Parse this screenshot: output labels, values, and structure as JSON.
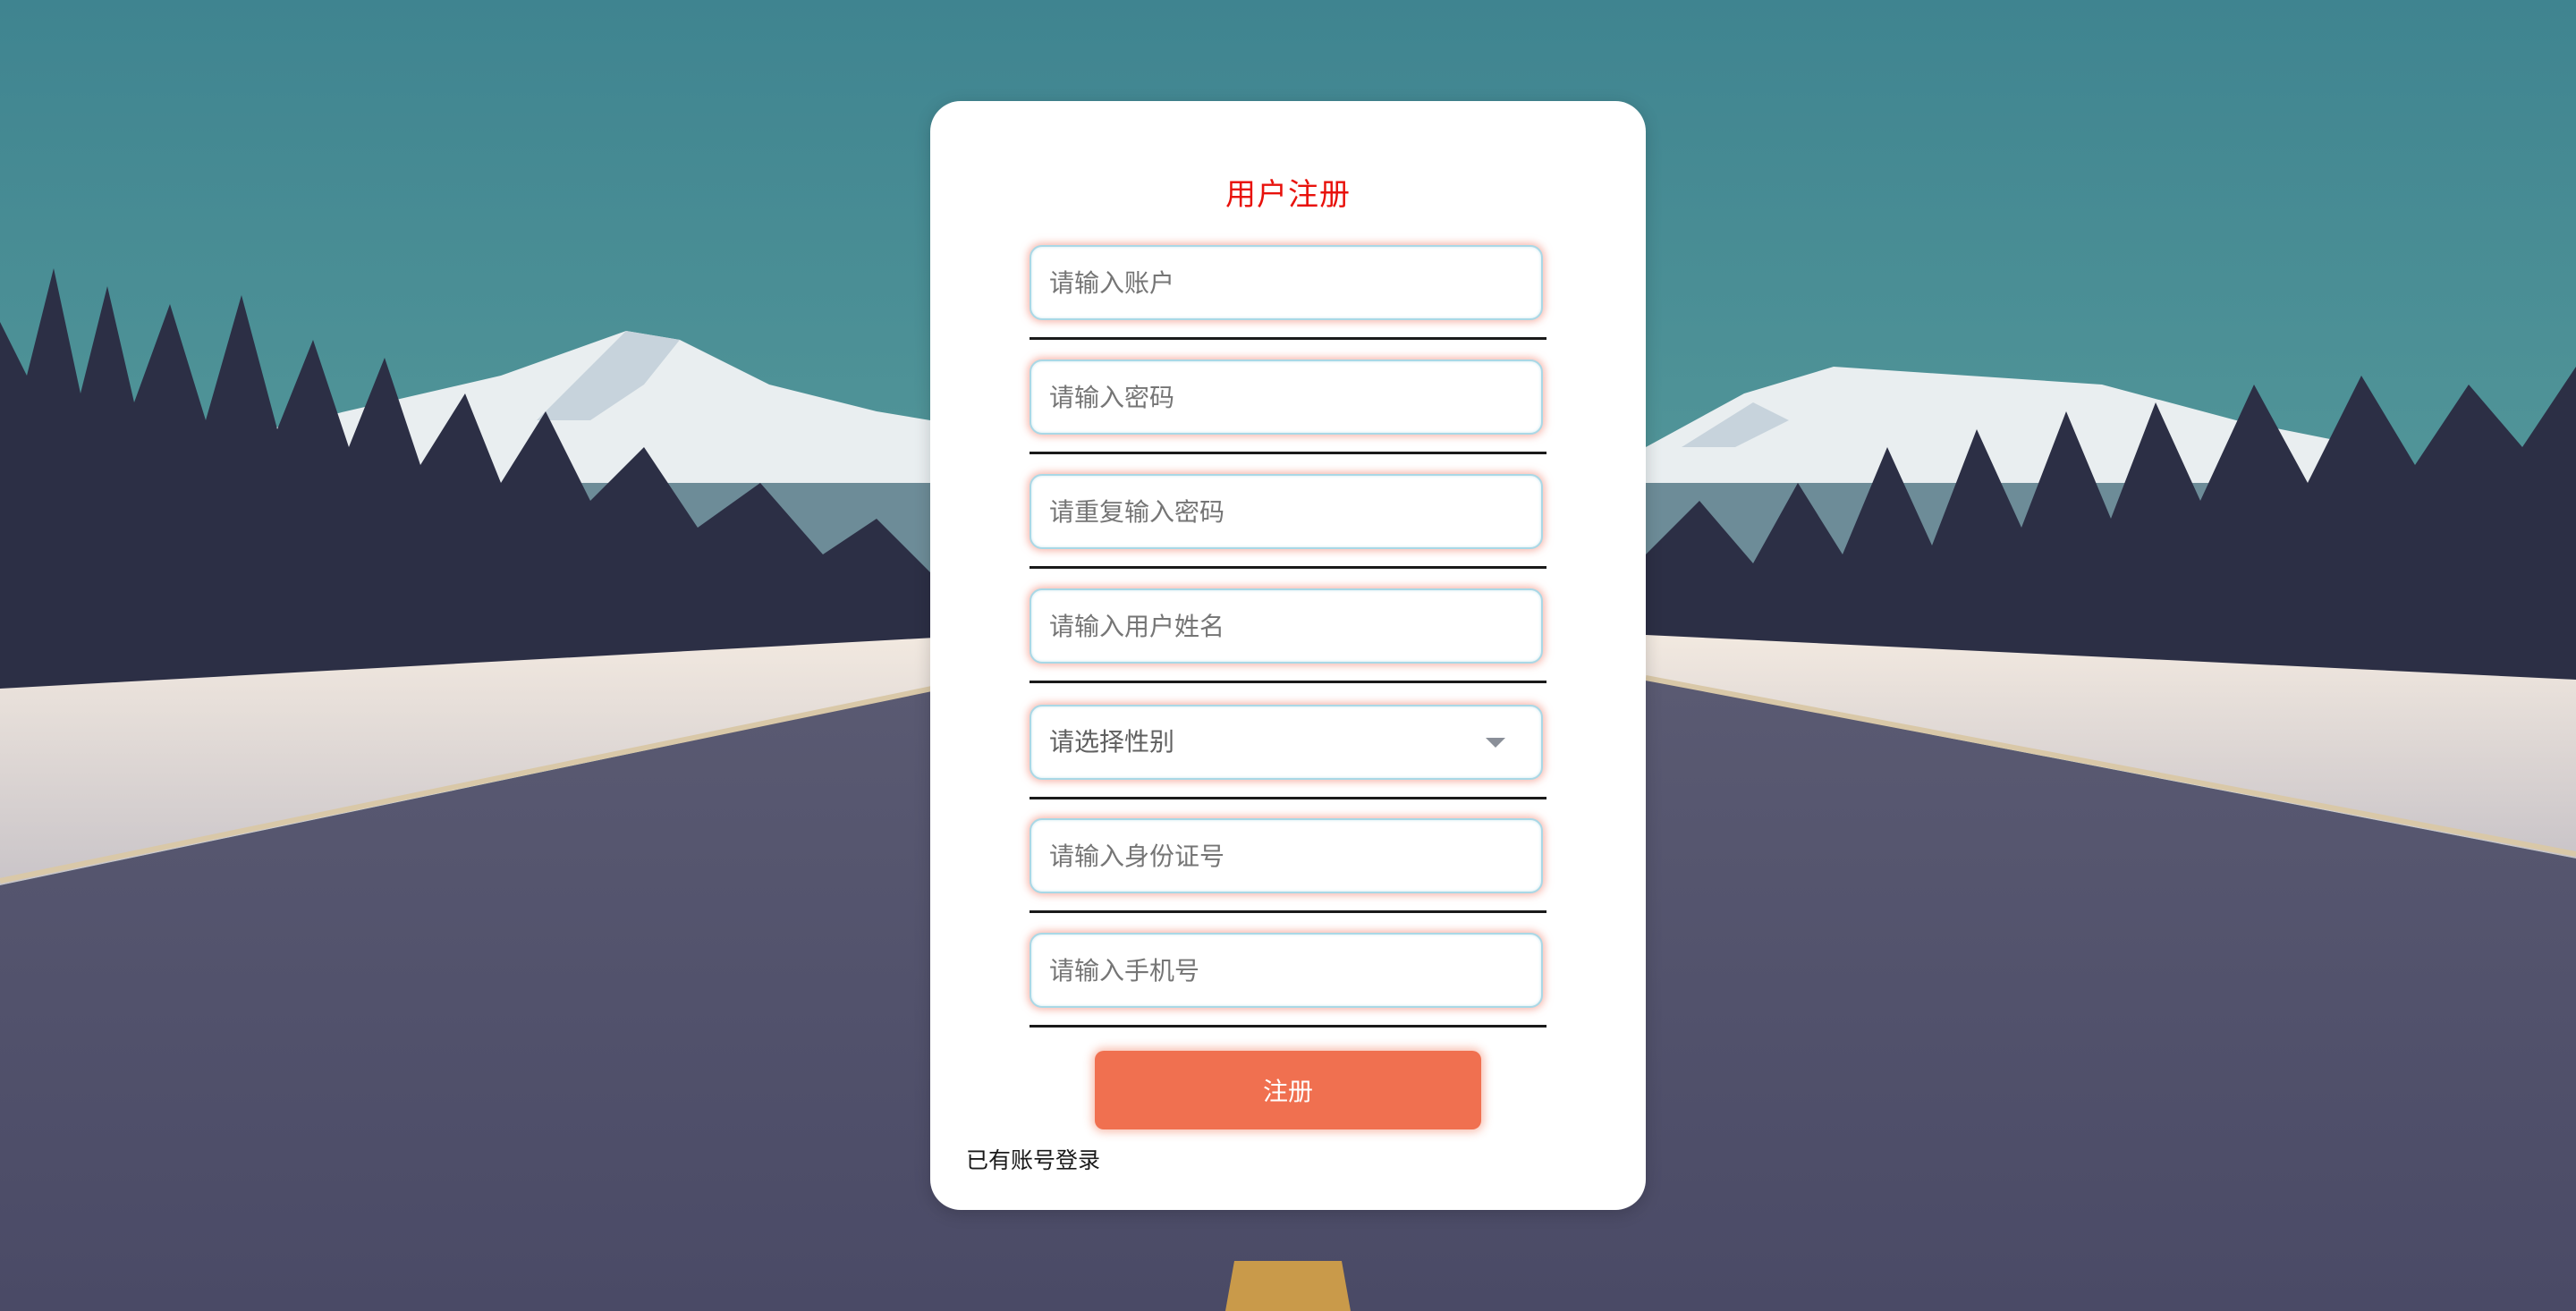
{
  "page": {
    "title": "用户注册"
  },
  "form": {
    "fields": [
      {
        "placeholder": "请输入账户",
        "value": ""
      },
      {
        "placeholder": "请输入密码",
        "value": ""
      },
      {
        "placeholder": "请重复输入密码",
        "value": ""
      },
      {
        "placeholder": "请输入用户姓名",
        "value": ""
      }
    ],
    "gender_select": {
      "selected_label": "请选择性别"
    },
    "fields_after": [
      {
        "placeholder": "请输入身份证号",
        "value": ""
      },
      {
        "placeholder": "请输入手机号",
        "value": ""
      }
    ],
    "submit_label": "注册",
    "login_link_label": "已有账号登录"
  },
  "colors": {
    "title": "#e8120c",
    "submit_button": "#f07050",
    "field_border": "#a9d8e6",
    "card_background": "#ffffff"
  }
}
